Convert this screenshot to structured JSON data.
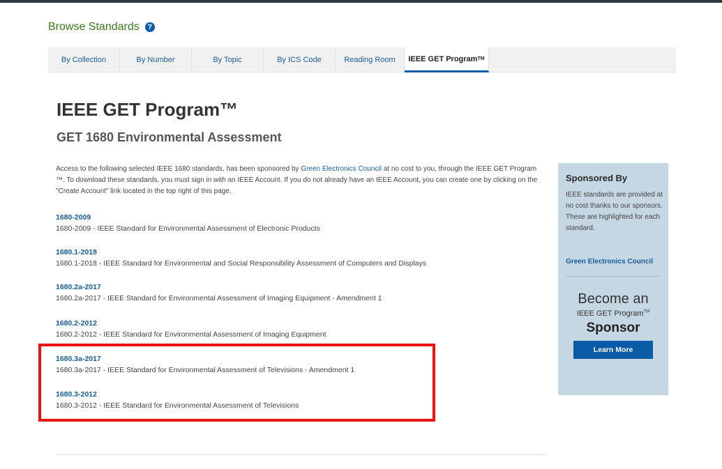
{
  "browse": {
    "title": "Browse Standards",
    "help_icon": "?"
  },
  "tabs": [
    {
      "label": "By Collection"
    },
    {
      "label": "By Number"
    },
    {
      "label": "By Topic"
    },
    {
      "label": "By ICS Code"
    },
    {
      "label": "Reading Room"
    },
    {
      "label": "IEEE GET Program",
      "sup": "TM"
    }
  ],
  "main": {
    "title": "IEEE GET Program™",
    "subtitle": "GET 1680 Environmental Assessment",
    "intro": {
      "part1": "Access to the following selected IEEE 1680 standards, has been sponsored by ",
      "link": "Green Electronics Council",
      "part2": " at no cost to you, through the IEEE GET Program ™. To download these standards, you must sign in with an IEEE Account. If you do not already have an IEEE Account, you can create one by clicking on the \"Create Account\" link located in the top right of this page."
    },
    "standards": [
      {
        "id": "1680-2009",
        "desc": "1680-2009 - IEEE Standard for Environmental Assessment of Electronic Products"
      },
      {
        "id": "1680.1-2018",
        "desc": "1680.1-2018 - IEEE Standard for Environmental and Social Responsibility Assessment of Computers and Displays"
      },
      {
        "id": "1680.2a-2017",
        "desc": "1680.2a-2017 - IEEE Standard for Environmental Assessment of Imaging Equipment - Amendment 1"
      },
      {
        "id": "1680.2-2012",
        "desc": "1680.2-2012 - IEEE Standard for Environmental Assessment of Imaging Equipment"
      },
      {
        "id": "1680.3a-2017",
        "desc": "1680.3a-2017 - IEEE Standard for Environmental Assessment of Televisions - Amendment 1"
      },
      {
        "id": "1680.3-2012",
        "desc": "1680.3-2012 - IEEE Standard for Environmental Assessment of Televisions"
      }
    ]
  },
  "sidebar": {
    "title": "Sponsored By",
    "text": "IEEE standards are provided at no cost thanks to our sponsors. These are highlighted for each standard.",
    "sponsor_link": "Green Electronics Council",
    "become_line1": "Become an",
    "become_line2": "IEEE GET Program",
    "become_line2_sup": "TM",
    "become_line3": "Sponsor",
    "learn_more": "Learn More"
  },
  "colors": {
    "header_green": "#3a7a1f",
    "link_blue": "#1a5c99",
    "button_blue": "#0a5aa5",
    "sidebar_bg": "#c5d7e3",
    "highlight_red": "#ee1111"
  }
}
